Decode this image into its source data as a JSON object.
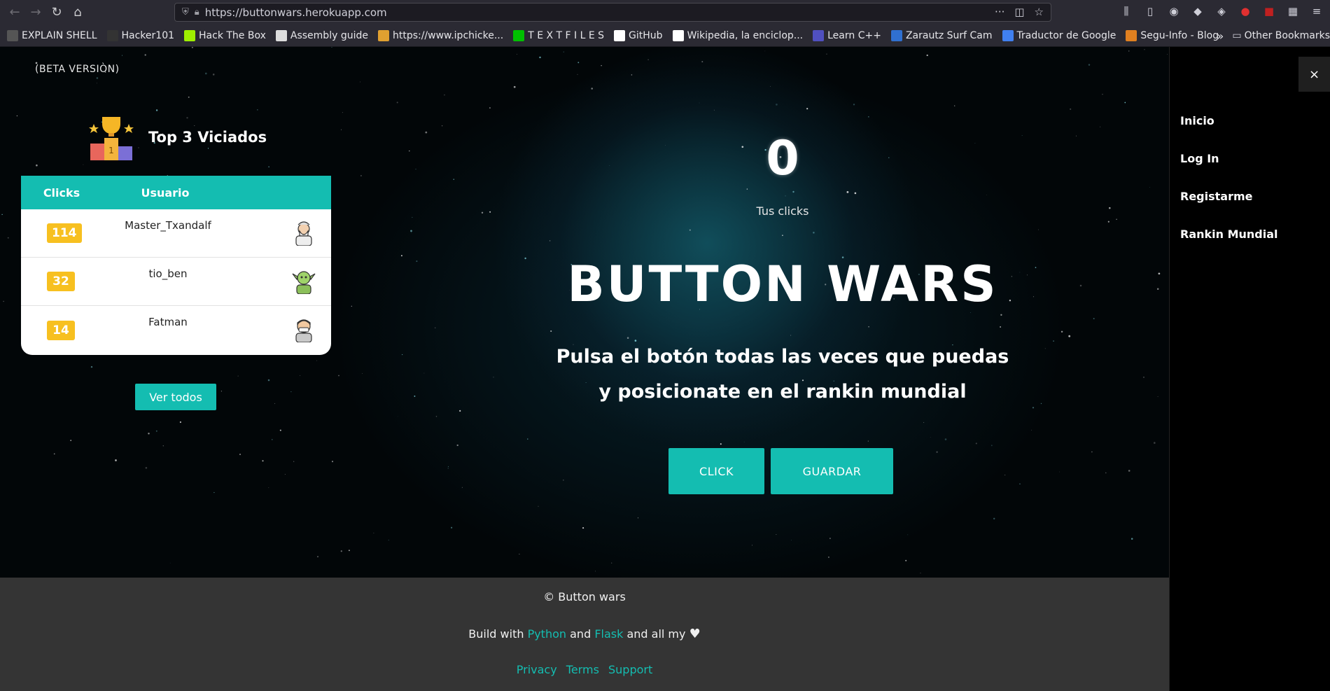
{
  "browser": {
    "url": "https://buttonwars.herokuapp.com",
    "bookmarks": [
      {
        "label": "EXPLAIN SHELL",
        "icon": "feather-icon",
        "color": "#555555"
      },
      {
        "label": "Hacker101",
        "icon": "101-icon",
        "color": "#333333"
      },
      {
        "label": "Hack The Box",
        "icon": "cube-icon",
        "color": "#9fef00"
      },
      {
        "label": "Assembly guide",
        "icon": "page-icon",
        "color": "#dddddd"
      },
      {
        "label": "https://www.ipchicke...",
        "icon": "chicken-icon",
        "color": "#e0a030"
      },
      {
        "label": "T E X T F I L E S",
        "icon": "terminal-icon",
        "color": "#00c000"
      },
      {
        "label": "GitHub",
        "icon": "github-icon",
        "color": "#ffffff"
      },
      {
        "label": "Wikipedia, la enciclop...",
        "icon": "wikipedia-icon",
        "color": "#ffffff"
      },
      {
        "label": "Learn C++",
        "icon": "cpp-icon",
        "color": "#5050c0"
      },
      {
        "label": "Zarautz Surf Cam",
        "icon": "globe-icon",
        "color": "#3070d0"
      },
      {
        "label": "Traductor de Google",
        "icon": "translate-icon",
        "color": "#4080f0"
      },
      {
        "label": "Segu-Info - Blog",
        "icon": "segu-icon",
        "color": "#e08020"
      }
    ],
    "other_bookmarks": "Other Bookmarks"
  },
  "header": {
    "beta": "(BETA VERSIÒN)"
  },
  "leaderboard": {
    "title": "Top 3 Viciados",
    "col_clicks": "Clicks",
    "col_user": "Usuario",
    "rows": [
      {
        "clicks": "114",
        "user": "Master_Txandalf",
        "avatar": "wizard-icon"
      },
      {
        "clicks": "32",
        "user": "tio_ben",
        "avatar": "goblin-icon"
      },
      {
        "clicks": "14",
        "user": "Fatman",
        "avatar": "man-mask-icon"
      }
    ],
    "see_all": "Ver todos"
  },
  "main": {
    "count": "0",
    "count_label": "Tus clicks",
    "title": "BUTTON WARS",
    "subtitle_line1": "Pulsa el botón todas las veces que puedas",
    "subtitle_line2": "y posicionate en el rankin mundial",
    "click_button": "CLICK",
    "save_button": "GUARDAR"
  },
  "sidebar": {
    "close": "×",
    "items": [
      "Inicio",
      "Log In",
      "Registarme",
      "Rankin Mundial"
    ]
  },
  "footer": {
    "copyright": "© Button wars",
    "build_prefix": "Build with ",
    "python": "Python",
    "and1": " and ",
    "flask": "Flask",
    "and2": " and all my ",
    "heart": "♥",
    "links": [
      "Privacy",
      "Terms",
      "Support"
    ]
  },
  "colors": {
    "accent": "#14bdb1",
    "badge": "#f7c020",
    "footer_bg": "#343434"
  }
}
